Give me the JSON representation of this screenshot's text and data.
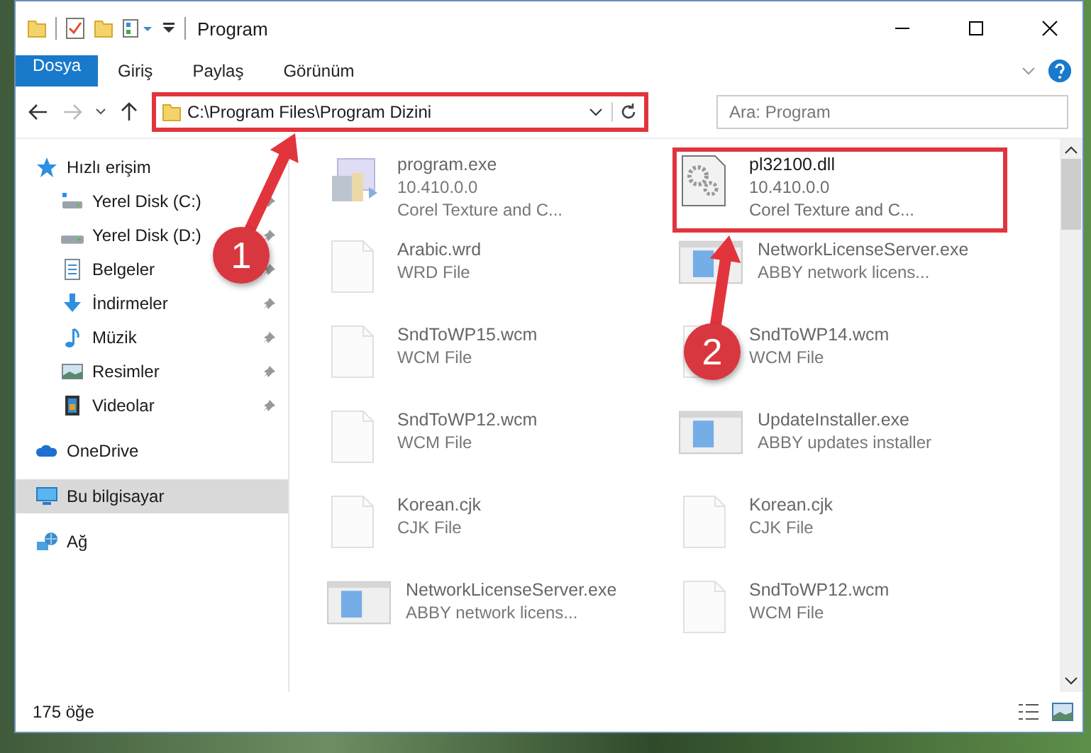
{
  "window": {
    "title": "Program"
  },
  "ribbon": {
    "tabs": [
      {
        "label": "Dosya",
        "kind": "file"
      },
      {
        "label": "Giriş",
        "kind": "tab"
      },
      {
        "label": "Paylaş",
        "kind": "tab"
      },
      {
        "label": "Görünüm",
        "kind": "tab"
      }
    ]
  },
  "address": {
    "path": "C:\\Program Files\\Program Dizini",
    "highlighted": true
  },
  "search": {
    "placeholder": "Ara: Program"
  },
  "sidebar": {
    "items": [
      {
        "label": "Hızlı erişim",
        "kind": "star",
        "pinned": false,
        "selected": false,
        "children": [
          {
            "label": "Yerel Disk (C:)",
            "kind": "sysdrive",
            "pinned": true,
            "selected": false
          },
          {
            "label": "Yerel Disk (D:)",
            "kind": "drive",
            "pinned": true,
            "selected": false
          },
          {
            "label": "Belgeler",
            "kind": "docs",
            "pinned": true,
            "selected": false
          },
          {
            "label": "İndirmeler",
            "kind": "download",
            "pinned": true,
            "selected": false
          },
          {
            "label": "Müzik",
            "kind": "music",
            "pinned": true,
            "selected": false
          },
          {
            "label": "Resimler",
            "kind": "pictures",
            "pinned": true,
            "selected": false
          },
          {
            "label": "Videolar",
            "kind": "videos",
            "pinned": true,
            "selected": false
          }
        ]
      },
      {
        "label": "OneDrive",
        "kind": "cloud",
        "pinned": false,
        "selected": false
      },
      {
        "label": "Bu bilgisayar",
        "kind": "pc",
        "pinned": false,
        "selected": true
      },
      {
        "label": "Ağ",
        "kind": "network",
        "pinned": false,
        "selected": false
      }
    ]
  },
  "files": [
    {
      "name": "program.exe",
      "details": [
        "10.410.0.0",
        "Corel Texture and C..."
      ],
      "kind": "installer",
      "blurred": true,
      "highlighted": false
    },
    {
      "name": "pl32100.dll",
      "details": [
        "10.410.0.0",
        "Corel Texture and C..."
      ],
      "kind": "dll",
      "blurred": false,
      "highlighted": true
    },
    {
      "name": "Arabic.wrd",
      "details": [
        "WRD File"
      ],
      "kind": "blank",
      "blurred": true,
      "highlighted": false
    },
    {
      "name": "NetworkLicenseServer.exe",
      "details": [
        "ABBY network licens..."
      ],
      "kind": "app",
      "blurred": true,
      "highlighted": false
    },
    {
      "name": "SndToWP15.wcm",
      "details": [
        "WCM File"
      ],
      "kind": "blank",
      "blurred": true,
      "highlighted": false
    },
    {
      "name": "SndToWP14.wcm",
      "details": [
        "WCM File"
      ],
      "kind": "blank",
      "blurred": true,
      "highlighted": false
    },
    {
      "name": "SndToWP12.wcm",
      "details": [
        "WCM File"
      ],
      "kind": "blank",
      "blurred": true,
      "highlighted": false
    },
    {
      "name": "UpdateInstaller.exe",
      "details": [
        "ABBY updates installer"
      ],
      "kind": "app",
      "blurred": true,
      "highlighted": false
    },
    {
      "name": "Korean.cjk",
      "details": [
        "CJK File"
      ],
      "kind": "blank",
      "blurred": true,
      "highlighted": false
    },
    {
      "name": "Korean.cjk",
      "details": [
        "CJK File"
      ],
      "kind": "blank",
      "blurred": true,
      "highlighted": false
    },
    {
      "name": "NetworkLicenseServer.exe",
      "details": [
        "ABBY network licens..."
      ],
      "kind": "app",
      "blurred": true,
      "highlighted": false
    },
    {
      "name": "SndToWP12.wcm",
      "details": [
        "WCM File"
      ],
      "kind": "blank",
      "blurred": true,
      "highlighted": false
    }
  ],
  "status_bar": {
    "count": "175 öğe"
  },
  "annotations": [
    {
      "label": "1"
    },
    {
      "label": "2"
    }
  ]
}
